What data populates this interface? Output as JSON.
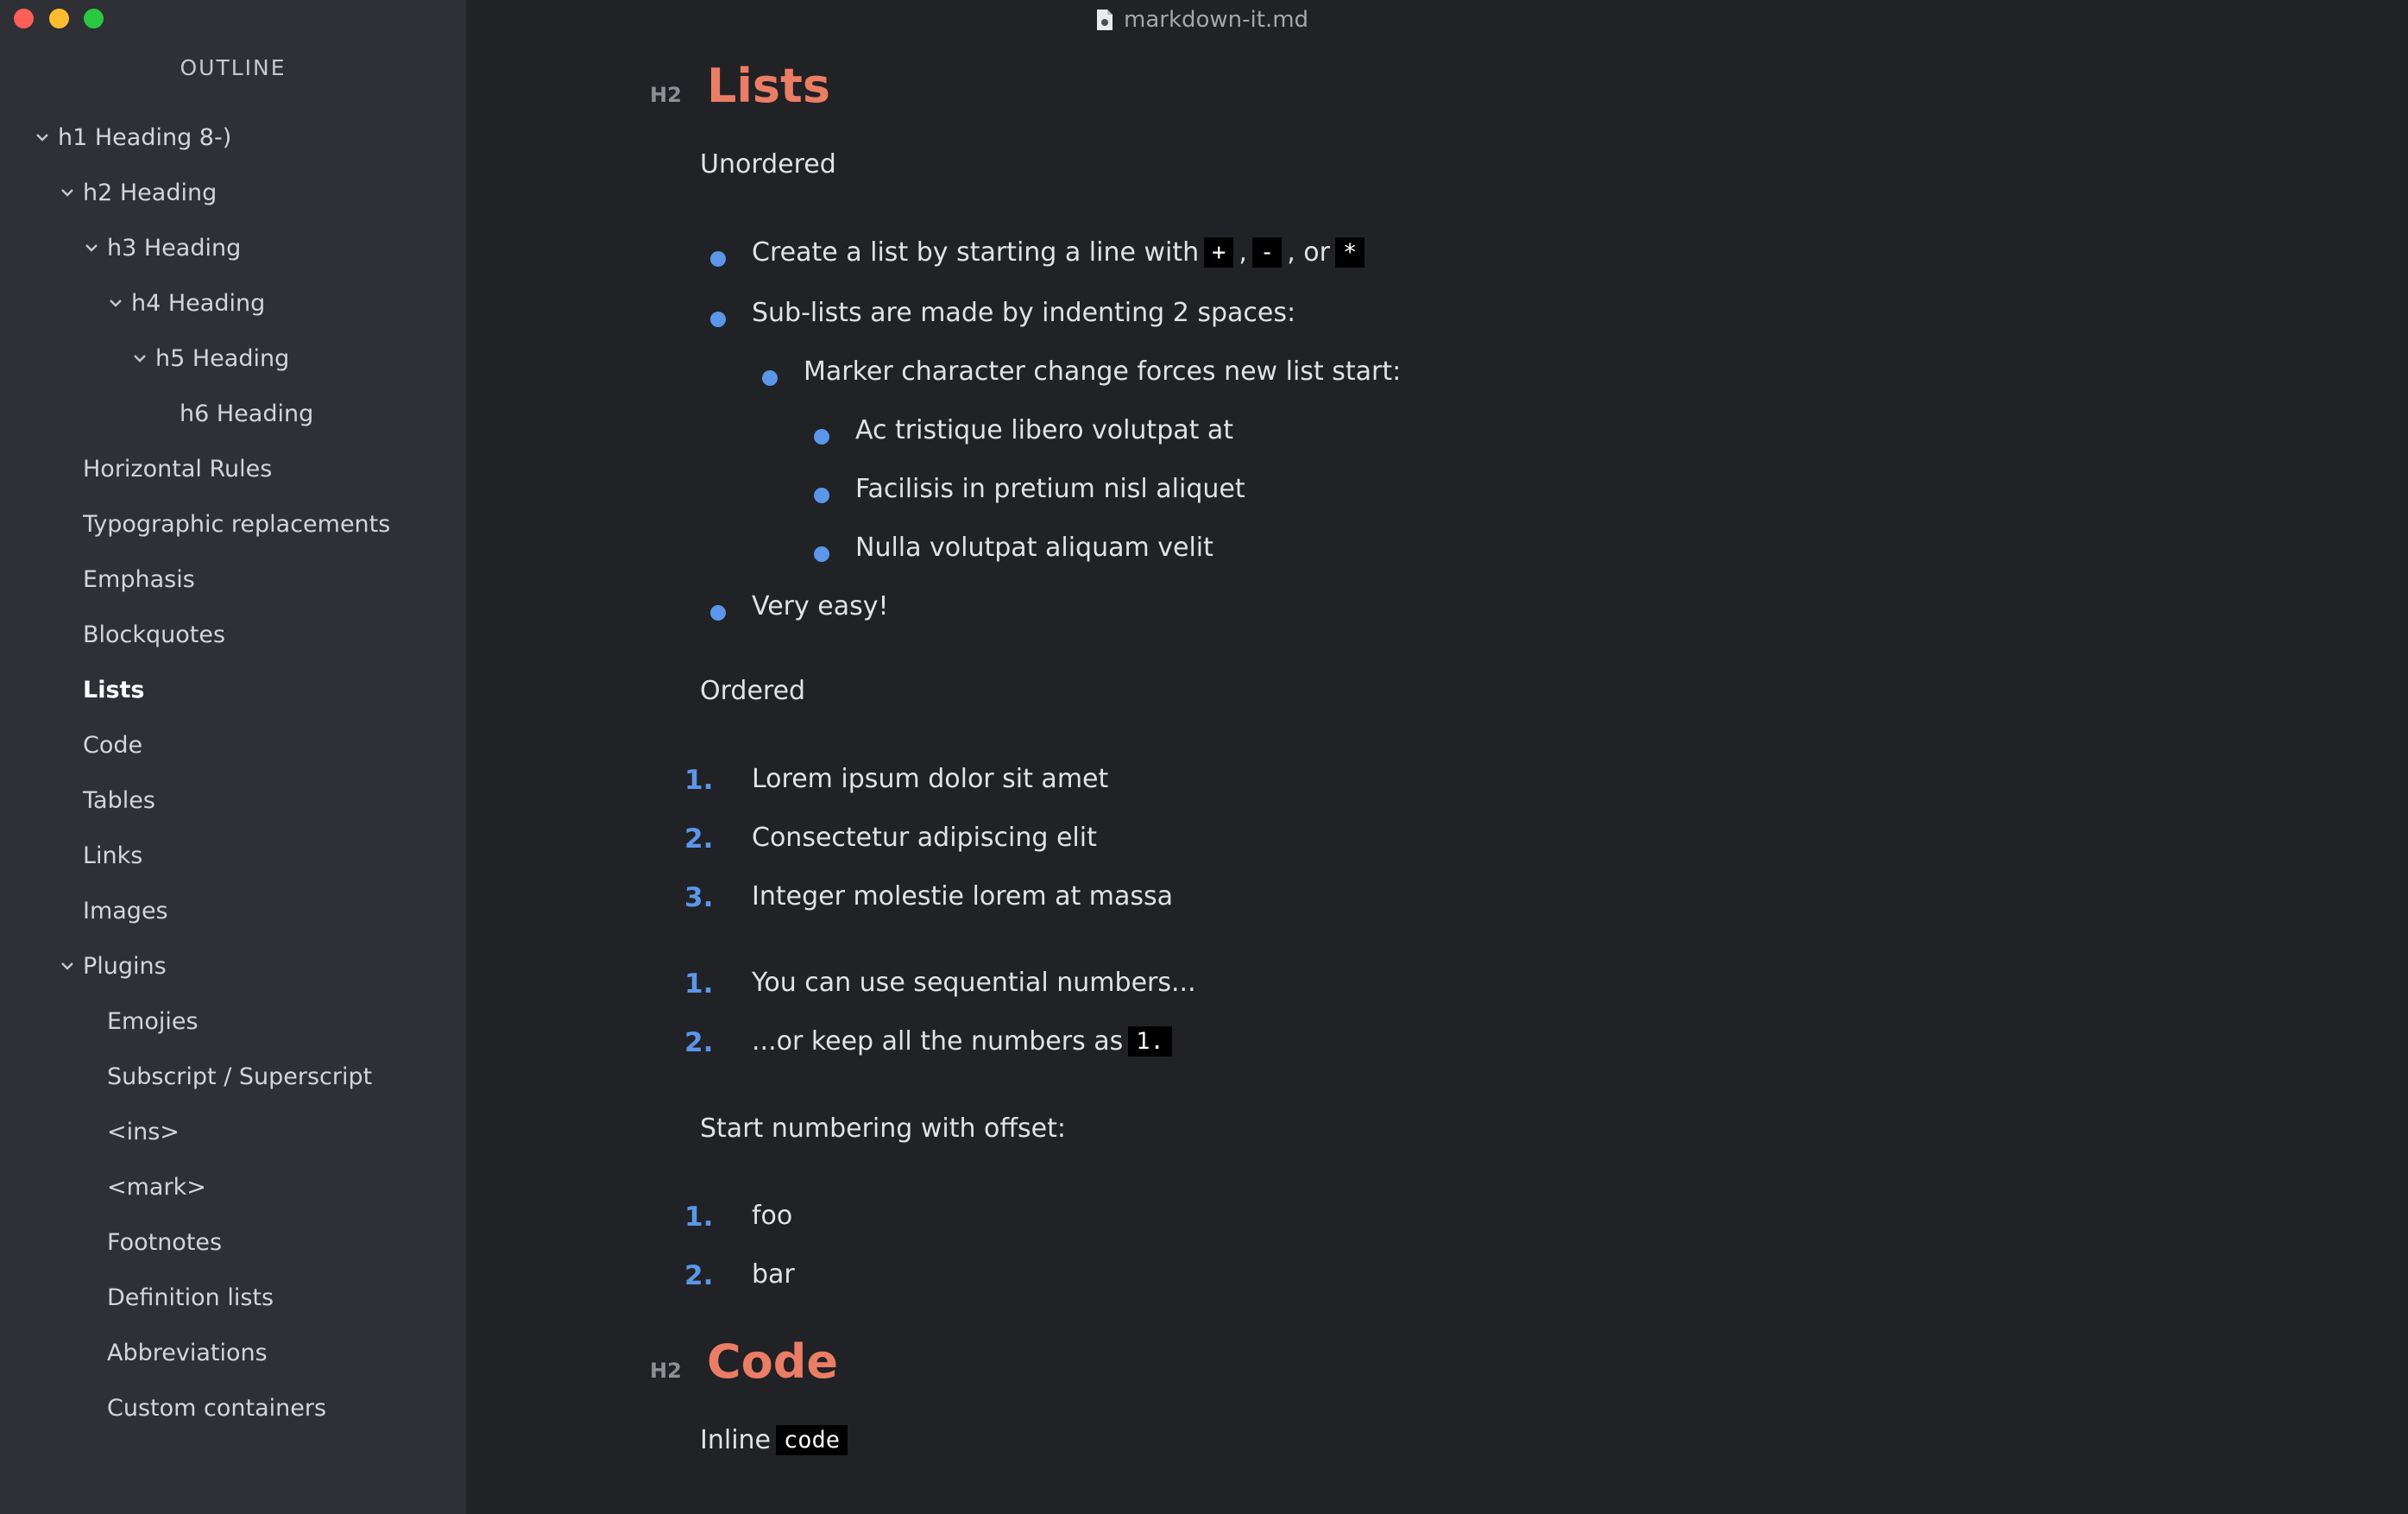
{
  "window": {
    "title": "markdown-it.md"
  },
  "sidebar": {
    "title": "OUTLINE",
    "items": [
      {
        "label": "h1 Heading 8-)",
        "collapsible": true
      },
      {
        "label": "h2 Heading",
        "collapsible": true
      },
      {
        "label": "h3 Heading",
        "collapsible": true
      },
      {
        "label": "h4 Heading",
        "collapsible": true
      },
      {
        "label": "h5 Heading",
        "collapsible": true
      },
      {
        "label": "h6 Heading",
        "collapsible": false
      },
      {
        "label": "Horizontal Rules",
        "collapsible": false
      },
      {
        "label": "Typographic replacements",
        "collapsible": false
      },
      {
        "label": "Emphasis",
        "collapsible": false
      },
      {
        "label": "Blockquotes",
        "collapsible": false
      },
      {
        "label": "Lists",
        "collapsible": false,
        "active": true
      },
      {
        "label": "Code",
        "collapsible": false
      },
      {
        "label": "Tables",
        "collapsible": false
      },
      {
        "label": "Links",
        "collapsible": false
      },
      {
        "label": "Images",
        "collapsible": false
      },
      {
        "label": "Plugins",
        "collapsible": true
      },
      {
        "label": "Emojies",
        "collapsible": false
      },
      {
        "label": "Subscript / Superscript",
        "collapsible": false
      },
      {
        "label": "<ins>",
        "collapsible": false
      },
      {
        "label": "<mark>",
        "collapsible": false
      },
      {
        "label": "Footnotes",
        "collapsible": false
      },
      {
        "label": "Definition lists",
        "collapsible": false
      },
      {
        "label": "Abbreviations",
        "collapsible": false
      },
      {
        "label": "Custom containers",
        "collapsible": false
      }
    ]
  },
  "editor": {
    "lists_heading": {
      "tag": "H2",
      "text": "Lists"
    },
    "unordered_label": "Unordered",
    "unordered": {
      "item1_prefix": "Create a list by starting a line with",
      "item1_code1": "+",
      "item1_sep1": ",",
      "item1_code2": "-",
      "item1_sep2": ", or",
      "item1_code3": "*",
      "item2": "Sub-lists are made by indenting 2 spaces:",
      "item2_1": "Marker character change forces new list start:",
      "item2_1_1": "Ac tristique libero volutpat at",
      "item2_1_2": "Facilisis in pretium nisl aliquet",
      "item2_1_3": "Nulla volutpat aliquam velit",
      "item3": "Very easy!"
    },
    "ordered_label": "Ordered",
    "ordered1": [
      {
        "num": "1.",
        "text": "Lorem ipsum dolor sit amet"
      },
      {
        "num": "2.",
        "text": "Consectetur adipiscing elit"
      },
      {
        "num": "3.",
        "text": "Integer molestie lorem at massa"
      }
    ],
    "ordered2": [
      {
        "num": "1.",
        "text": "You can use sequential numbers..."
      },
      {
        "num": "2.",
        "text": "...or keep all the numbers as",
        "code": "1."
      }
    ],
    "offset_label": "Start numbering with offset:",
    "ordered3": [
      {
        "num": "1.",
        "text": "foo"
      },
      {
        "num": "2.",
        "text": "bar"
      }
    ],
    "code_heading": {
      "tag": "H2",
      "text": "Code"
    },
    "inline_label": "Inline",
    "inline_code": "code"
  },
  "colors": {
    "heading": "#ea7d63",
    "list_marker": "#5a96ea",
    "sidebar_bg": "#2f3035",
    "editor_bg": "#212225"
  }
}
